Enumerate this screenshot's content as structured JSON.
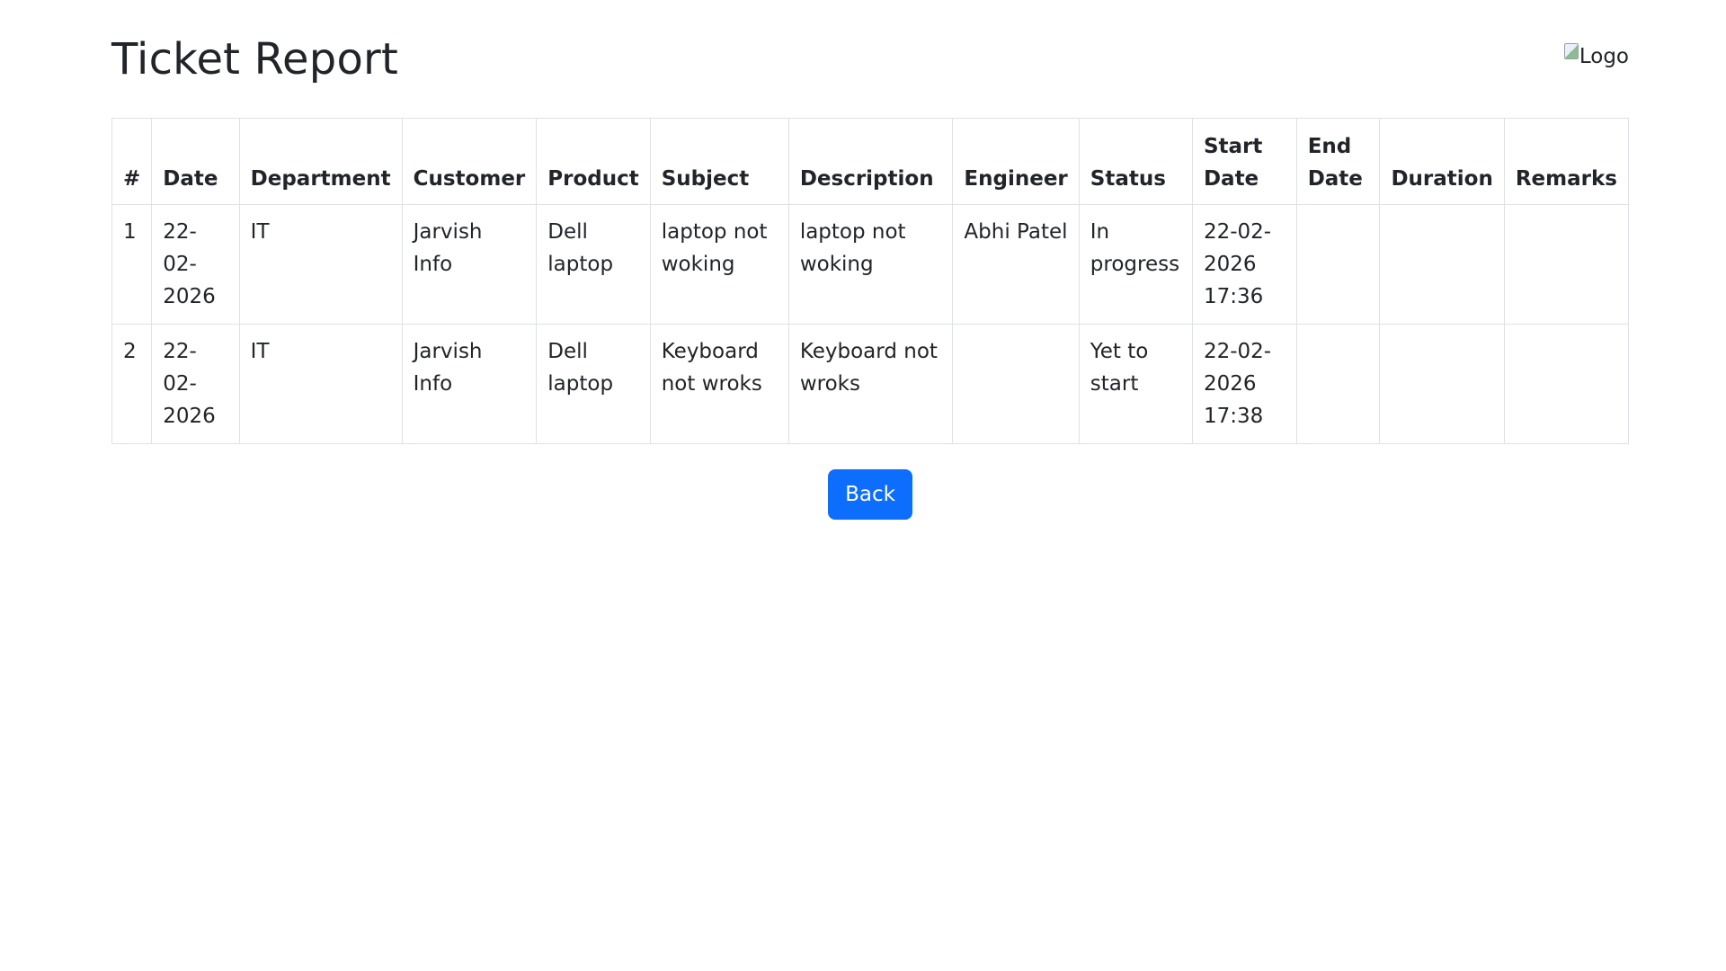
{
  "page": {
    "title": "Ticket Report",
    "logo_alt": "Logo"
  },
  "table": {
    "columns": [
      "#",
      "Date",
      "Department",
      "Customer",
      "Product",
      "Subject",
      "Description",
      "Engineer",
      "Status",
      "Start Date",
      "End Date",
      "Duration",
      "Remarks"
    ],
    "rows": [
      [
        "1",
        "22-02-2026",
        "IT",
        "Jarvish Info",
        "Dell laptop",
        "laptop not woking",
        "laptop not woking",
        "Abhi Patel",
        "In progress",
        "22-02-2026 17:36",
        "",
        "",
        ""
      ],
      [
        "2",
        "22-02-2026",
        "IT",
        "Jarvish Info",
        "Dell laptop",
        "Keyboard not wroks",
        "Keyboard not wroks",
        "",
        "Yet to start",
        "22-02-2026 17:38",
        "",
        "",
        ""
      ]
    ]
  },
  "actions": {
    "back_label": "Back"
  },
  "colors": {
    "accent": "#0d6efd",
    "border": "#dee2e6",
    "text": "#212529"
  }
}
